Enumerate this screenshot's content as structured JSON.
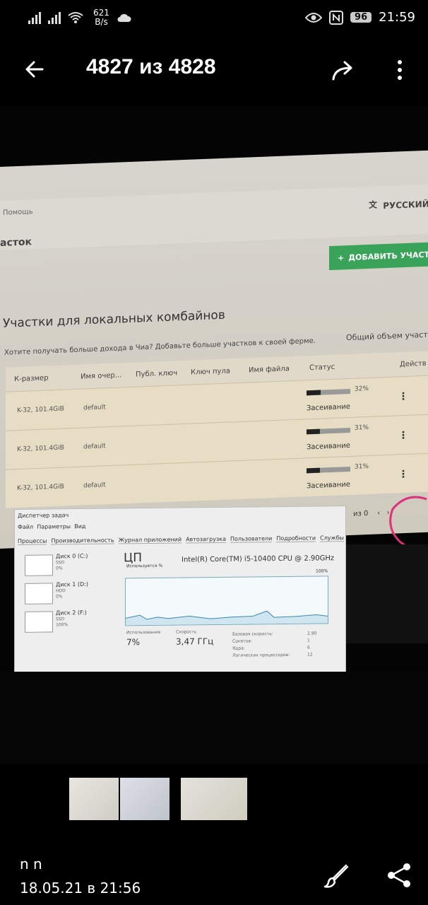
{
  "status": {
    "speed_value": "621",
    "speed_unit": "B/s",
    "battery": "96",
    "time": "21:59"
  },
  "viewer": {
    "counter": "4827 из 4828"
  },
  "farm": {
    "help": "Помощь",
    "language": "РУССКИЙ",
    "page_title": "асток",
    "add_button": "ДОБАВИТЬ УЧАСТ",
    "section_title": "Участки для локальных комбайнов",
    "hint": "Хотите получать больше дохода в Чиа? Добавьте больше участков к своей ферме.",
    "total_label": "Общий объем участ",
    "columns": [
      "К-размер",
      "Имя очер...",
      "Публ. ключ",
      "Ключ пула",
      "Имя файла",
      "Статус",
      "Действ"
    ],
    "rows": [
      {
        "size": "K-32, 101.4GiB",
        "queue": "default",
        "progress": "32%",
        "status": "Засеивание"
      },
      {
        "size": "K-32, 101.4GiB",
        "queue": "default",
        "progress": "31%",
        "status": "Засеивание"
      },
      {
        "size": "K-32, 101.4GiB",
        "queue": "default",
        "progress": "31%",
        "status": "Засеивание"
      }
    ],
    "pager": "из 0"
  },
  "taskmanager": {
    "title": "Диспетчер задач",
    "menu": [
      "Файл",
      "Параметры",
      "Вид"
    ],
    "tabs": [
      "Процессы",
      "Производительность",
      "Журнал приложений",
      "Автозагрузка",
      "Пользователи",
      "Подробности",
      "Службы"
    ],
    "disks": [
      {
        "name": "Диск 0 (C:)",
        "type": "SSD",
        "pct": "0%"
      },
      {
        "name": "Диск 1 (D:)",
        "type": "HDD",
        "pct": "0%"
      },
      {
        "name": "Диск 2 (F:)",
        "type": "SSD",
        "pct": "100%"
      }
    ],
    "cpu_title": "ЦП",
    "cpu_model": "Intel(R) Core(TM) i5-10400 CPU @ 2.90GHz",
    "util_label": "Используется %",
    "max_label": "100%",
    "usage_label": "Использование",
    "usage_value": "7%",
    "speed_label": "Скорость",
    "speed_value": "3,47 ГГц",
    "base_label": "Базовая скорость:",
    "base_value": "2,90",
    "sockets_label": "Сокетов:",
    "sockets_value": "1",
    "cores_label": "Ядра:",
    "cores_value": "6",
    "logical_label": "Логических процессоров:",
    "logical_value": "12"
  },
  "caption": {
    "name": "n n",
    "date": "18.05.21 в 21:56"
  }
}
